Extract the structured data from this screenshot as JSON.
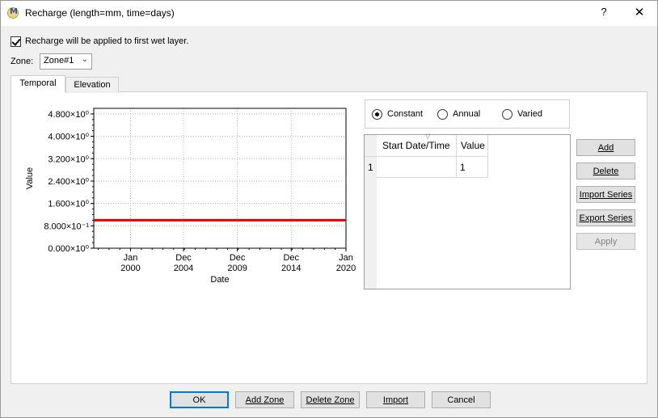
{
  "window": {
    "title": "Recharge (length=mm, time=days)",
    "help_label": "?",
    "close_label": "✕"
  },
  "options": {
    "checkbox_label": "Recharge will be applied to first wet layer.",
    "checked": true
  },
  "zone": {
    "label": "Zone:",
    "value": "Zone#1"
  },
  "tabs": [
    {
      "label": "Temporal",
      "active": true
    },
    {
      "label": "Elevation",
      "active": false
    }
  ],
  "mode": {
    "options": [
      {
        "label": "Constant",
        "selected": true
      },
      {
        "label": "Annual",
        "selected": false
      },
      {
        "label": "Varied",
        "selected": false
      }
    ]
  },
  "grid": {
    "columns": [
      "Start Date/Time",
      "Value"
    ],
    "rows": [
      {
        "index": "1",
        "start": "",
        "value": "1"
      }
    ]
  },
  "side_buttons": [
    {
      "label": "Add",
      "enabled": true
    },
    {
      "label": "Delete",
      "enabled": true
    },
    {
      "label": "Import Series",
      "enabled": true
    },
    {
      "label": "Export Series",
      "enabled": true
    },
    {
      "label": "Apply",
      "enabled": false
    }
  ],
  "bottom_buttons": [
    {
      "label": "OK",
      "default": true
    },
    {
      "label": "Add Zone",
      "default": false
    },
    {
      "label": "Delete Zone",
      "default": false
    },
    {
      "label": "Import",
      "default": false
    },
    {
      "label": "Cancel",
      "default": false
    }
  ],
  "chart_data": {
    "type": "line",
    "title": "",
    "xlabel": "Date",
    "ylabel": "Value",
    "ylim": [
      0,
      5.0
    ],
    "xlim": [
      "1996-08-01",
      "2020-01-01"
    ],
    "yticks": [
      {
        "value": 0.0,
        "label": "0.000×10⁰"
      },
      {
        "value": 0.8,
        "label": "8.000×10⁻¹"
      },
      {
        "value": 1.6,
        "label": "1.600×10⁰"
      },
      {
        "value": 2.4,
        "label": "2.400×10⁰"
      },
      {
        "value": 3.2,
        "label": "3.200×10⁰"
      },
      {
        "value": 4.0,
        "label": "4.000×10⁰"
      },
      {
        "value": 4.8,
        "label": "4.800×10⁰"
      }
    ],
    "xticks": [
      {
        "date": "2000-01-01",
        "line1": "Jan",
        "line2": "2000"
      },
      {
        "date": "2004-12-01",
        "line1": "Dec",
        "line2": "2004"
      },
      {
        "date": "2009-12-01",
        "line1": "Dec",
        "line2": "2009"
      },
      {
        "date": "2014-12-01",
        "line1": "Dec",
        "line2": "2014"
      },
      {
        "date": "2020-01-01",
        "line1": "Jan",
        "line2": "2020"
      }
    ],
    "grid": true,
    "series": [
      {
        "color": "#e00000",
        "points": [
          {
            "x": "1996-08-01",
            "y": 1.0
          },
          {
            "x": "2020-01-01",
            "y": 1.0
          }
        ]
      }
    ]
  }
}
